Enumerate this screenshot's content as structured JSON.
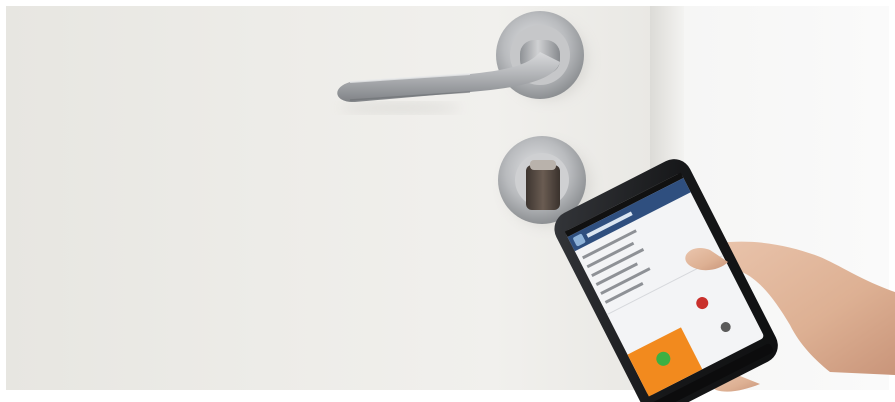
{
  "scene": {
    "description_visible_text": "",
    "colors": {
      "door": "#ebeae6",
      "wall": "#f8f8f7",
      "chrome": "#a9abad",
      "phone_body": "#1b1c1e",
      "screen_bg": "#f3f4f6",
      "screen_header": "#2f4f7f",
      "accent_orange": "#f28a1e",
      "accent_red": "#c9302c",
      "skin": "#e2b89e"
    }
  }
}
